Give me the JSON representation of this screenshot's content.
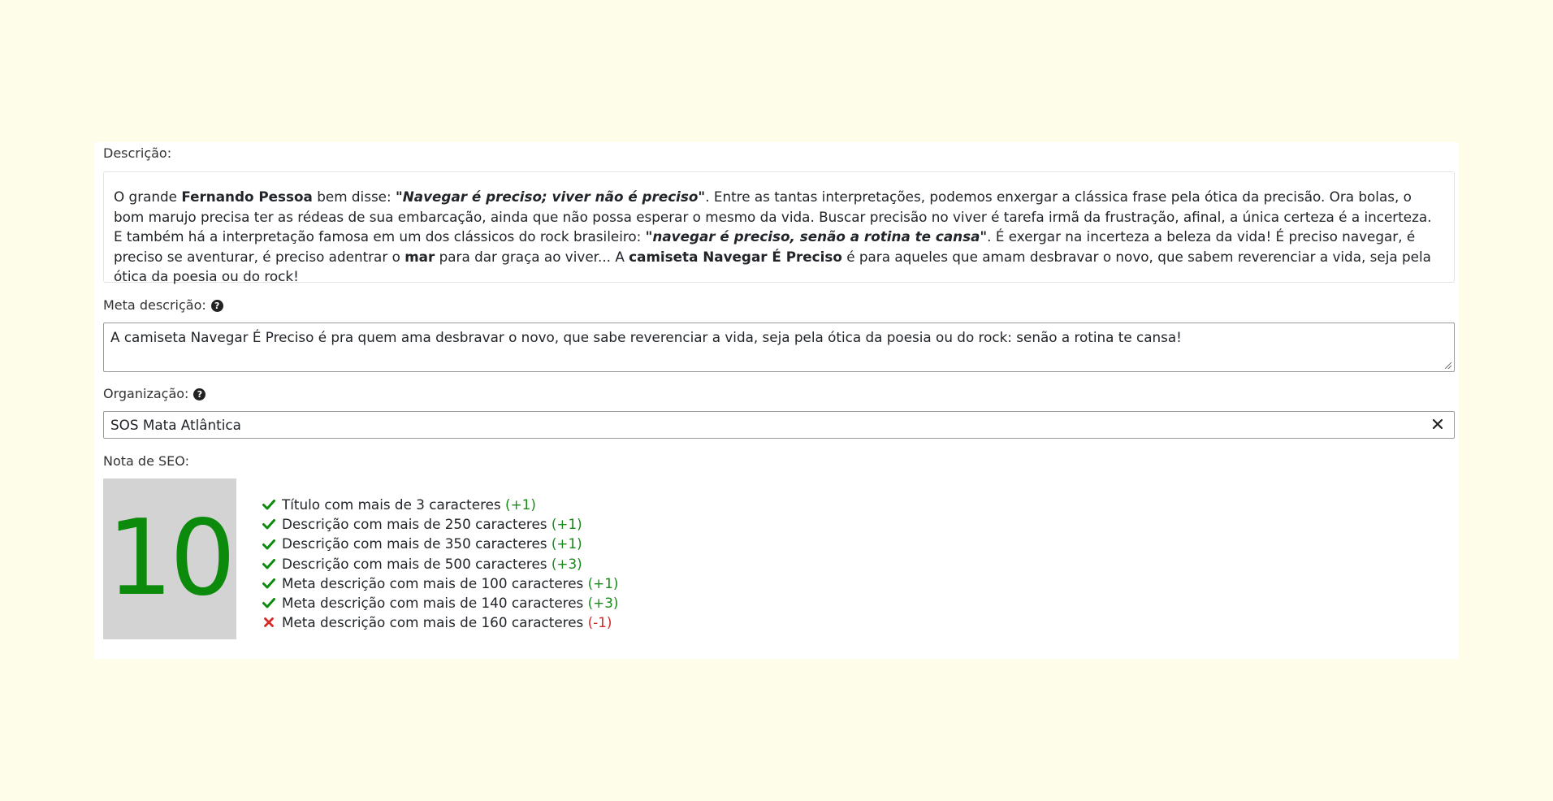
{
  "description": {
    "label": "Descrição:",
    "segments": [
      {
        "text": "O grande ",
        "style": "normal"
      },
      {
        "text": "Fernando Pessoa",
        "style": "bold"
      },
      {
        "text": " bem disse: ",
        "style": "normal"
      },
      {
        "text": "\"Navegar é preciso; viver não é preciso\"",
        "style": "bold-italic"
      },
      {
        "text": ". Entre as tantas interpretações, podemos enxergar a clássica frase pela ótica da precisão. Ora bolas, o bom marujo precisa ter as rédeas de sua embarcação, ainda que não possa esperar o mesmo da vida. Buscar precisão no viver é tarefa irmã da frustração, afinal, a única certeza é a incerteza. E também há a interpretação famosa em um dos clássicos do rock brasileiro: ",
        "style": "normal"
      },
      {
        "text": "\"navegar é preciso, senão a rotina te cansa\"",
        "style": "bold-italic"
      },
      {
        "text": ". É exergar na incerteza a beleza da vida! É preciso navegar, é preciso se aventurar, é preciso adentrar o ",
        "style": "normal"
      },
      {
        "text": "mar",
        "style": "bold"
      },
      {
        "text": " para dar graça ao viver... A ",
        "style": "normal"
      },
      {
        "text": "camiseta Navegar É Preciso",
        "style": "bold"
      },
      {
        "text": " é para aqueles que amam desbravar o novo, que sabem reverenciar a vida, seja pela ótica da poesia ou do rock!",
        "style": "normal"
      }
    ]
  },
  "meta": {
    "label": "Meta descrição:",
    "help_icon": "question-circle-icon",
    "value": "A camiseta Navegar É Preciso é pra quem ama desbravar o novo, que sabe reverenciar a vida, seja pela ótica da poesia ou do rock: senão a rotina te cansa!"
  },
  "organization": {
    "label": "Organização:",
    "help_icon": "question-circle-icon",
    "value": "SOS Mata Atlântica",
    "clear_icon": "close-icon"
  },
  "seo": {
    "label": "Nota de SEO:",
    "score": "10",
    "score_color": "#0b8a0b",
    "criteria": [
      {
        "text": "Título com mais de 3 caracteres",
        "points": "(+1)",
        "passed": true
      },
      {
        "text": "Descrição com mais de 250 caracteres",
        "points": "(+1)",
        "passed": true
      },
      {
        "text": "Descrição com mais de 350 caracteres",
        "points": "(+1)",
        "passed": true
      },
      {
        "text": "Descrição com mais de 500 caracteres",
        "points": "(+3)",
        "passed": true
      },
      {
        "text": "Meta descrição com mais de 100 caracteres",
        "points": "(+1)",
        "passed": true
      },
      {
        "text": "Meta descrição com mais de 140 caracteres",
        "points": "(+3)",
        "passed": true
      },
      {
        "text": "Meta descrição com mais de 160 caracteres",
        "points": "(-1)",
        "passed": false
      }
    ],
    "pass_color": "#0b8a0b",
    "fail_color": "#d62828",
    "pass_icon": "check-icon",
    "fail_icon": "cross-icon"
  }
}
